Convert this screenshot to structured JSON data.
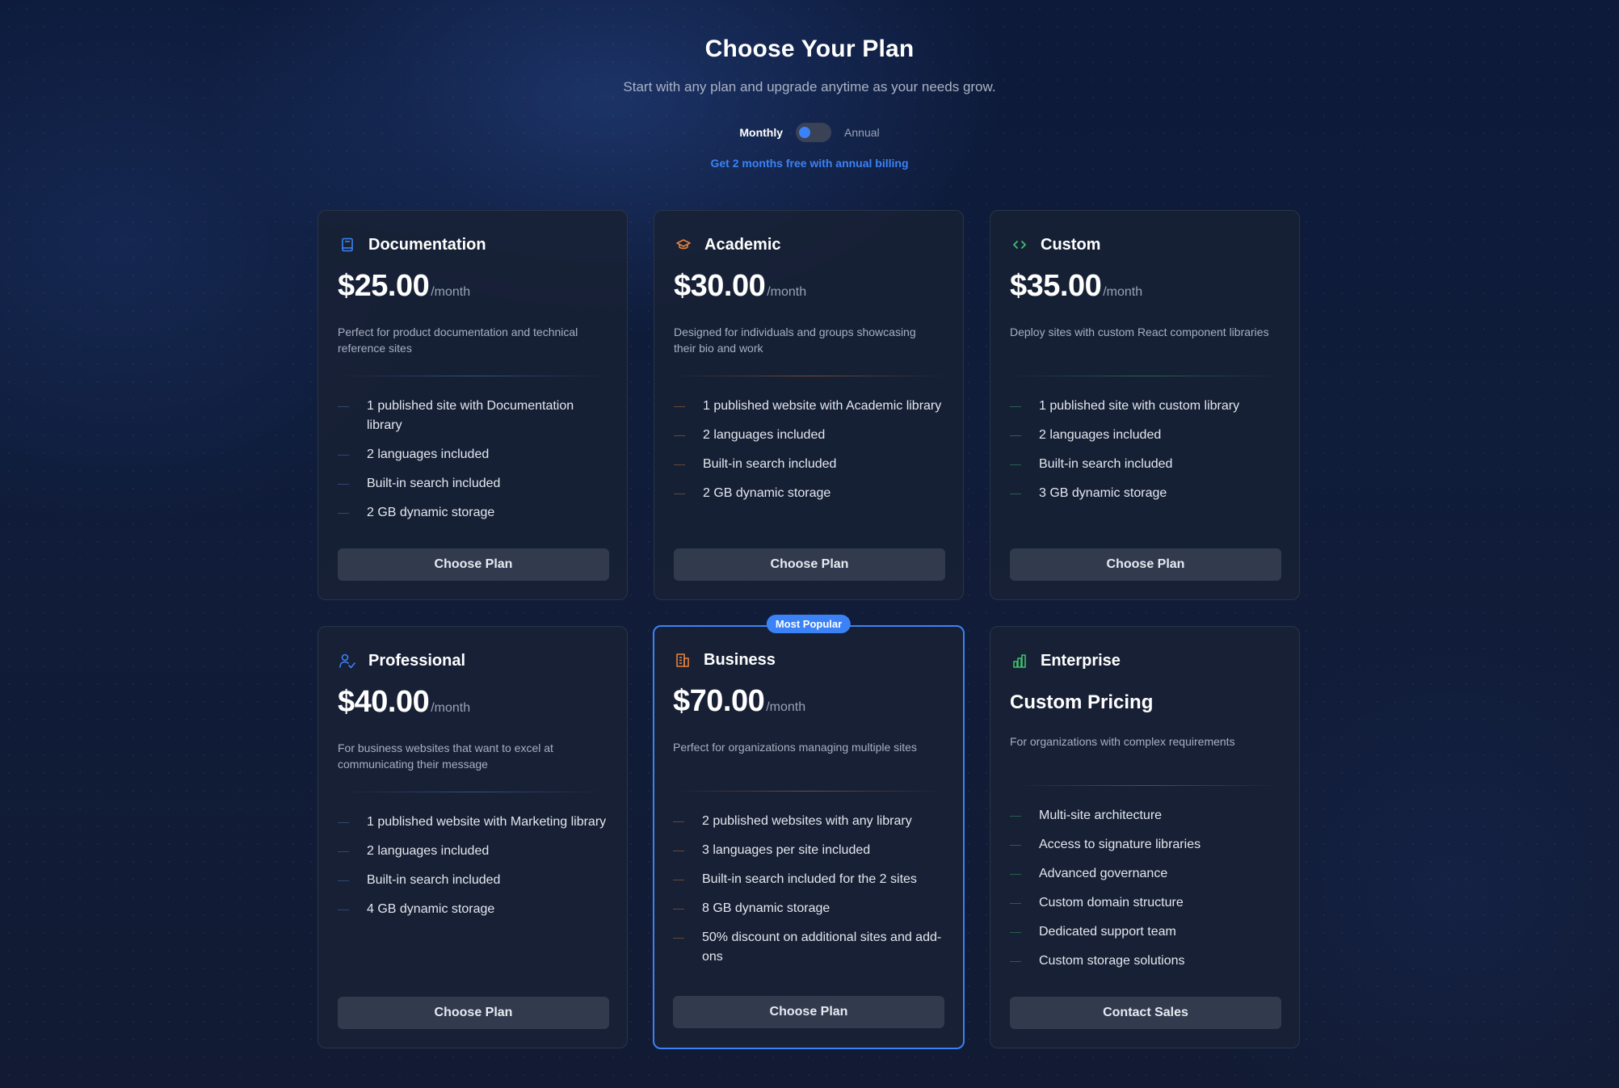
{
  "header": {
    "title": "Choose Your Plan",
    "subtitle": "Start with any plan and upgrade anytime as your needs grow.",
    "billing": {
      "monthly_label": "Monthly",
      "annual_label": "Annual",
      "selected": "Monthly"
    },
    "promo": "Get 2 months free with annual billing"
  },
  "colors": {
    "accent_blue": "#3b82f6",
    "accent_orange": "#e8823a",
    "accent_green": "#3fbf6f"
  },
  "plans": [
    {
      "name": "Documentation",
      "icon": "book-icon",
      "price": "$25.00",
      "per": "/month",
      "description": "Perfect for product documentation and technical reference sites",
      "features": [
        "1 published site with Documentation library",
        "2 languages included",
        "Built-in search included",
        "2 GB dynamic storage"
      ],
      "button": "Choose Plan"
    },
    {
      "name": "Academic",
      "icon": "graduation-cap-icon",
      "price": "$30.00",
      "per": "/month",
      "description": "Designed for individuals and groups showcasing their bio and work",
      "features": [
        "1 published website with Academic library",
        "2 languages included",
        "Built-in search included",
        "2 GB dynamic storage"
      ],
      "button": "Choose Plan"
    },
    {
      "name": "Custom",
      "icon": "code-icon",
      "price": "$35.00",
      "per": "/month",
      "description": "Deploy sites with custom React component libraries",
      "features": [
        "1 published site with custom library",
        "2 languages included",
        "Built-in search included",
        "3 GB dynamic storage"
      ],
      "button": "Choose Plan"
    },
    {
      "name": "Professional",
      "icon": "user-check-icon",
      "price": "$40.00",
      "per": "/month",
      "description": "For business websites that want to excel at communicating their message",
      "features": [
        "1 published website with Marketing library",
        "2 languages included",
        "Built-in search included",
        "4 GB dynamic storage"
      ],
      "button": "Choose Plan"
    },
    {
      "name": "Business",
      "icon": "building-icon",
      "price": "$70.00",
      "per": "/month",
      "badge": "Most Popular",
      "description": "Perfect for organizations managing multiple sites",
      "features": [
        "2 published websites with any library",
        "3 languages per site included",
        "Built-in search included for the 2 sites",
        "8 GB dynamic storage",
        "50% discount on additional sites and add-ons"
      ],
      "button": "Choose Plan"
    },
    {
      "name": "Enterprise",
      "icon": "bar-chart-icon",
      "price": "Custom Pricing",
      "description": "For organizations with complex requirements",
      "features": [
        "Multi-site architecture",
        "Access to signature libraries",
        "Advanced governance",
        "Custom domain structure",
        "Dedicated support team",
        "Custom storage solutions"
      ],
      "button": "Contact Sales"
    }
  ]
}
